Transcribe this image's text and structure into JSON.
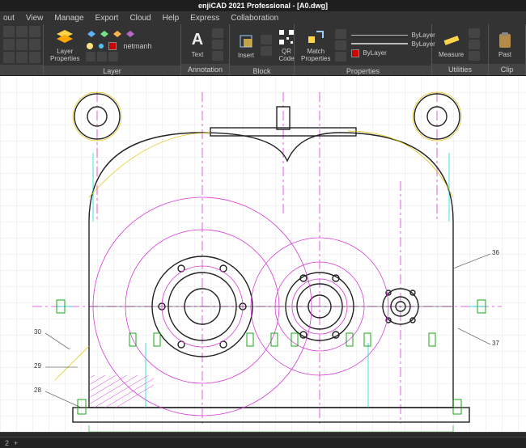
{
  "app": {
    "title": "enjiCAD 2021 Professional - [A0.dwg]"
  },
  "menu": {
    "items": [
      "out",
      "View",
      "Manage",
      "Export",
      "Cloud",
      "Help",
      "Express",
      "Collaboration"
    ]
  },
  "ribbon": {
    "layer_panel": {
      "label": "Layer",
      "layer_properties_btn": "Layer\nProperties",
      "current_layer": "netmanh"
    },
    "annotation_panel": {
      "label": "Annotation",
      "text_btn": "Text"
    },
    "block_panel": {
      "label": "Block",
      "insert_btn": "Insert",
      "qr_btn": "QR\nCode"
    },
    "properties_panel": {
      "label": "Properties",
      "match_btn": "Match\nProperties",
      "line_bylayer": "ByLayer",
      "weight_bylayer": "ByLayer",
      "color_bylayer": "ByLayer"
    },
    "utilities_panel": {
      "label": "Utilities",
      "measure_btn": "Measure"
    },
    "clipboard_panel": {
      "label": "Clip",
      "paste_btn": "Past"
    }
  },
  "drawing": {
    "callouts": {
      "c28": "28",
      "c29": "29",
      "c30": "30",
      "c36": "36",
      "c37": "37"
    },
    "colors": {
      "outline": "#222",
      "magenta": "#d63bd6",
      "cyan": "#00d0d0",
      "yellow": "#e0c000",
      "green": "#00a000",
      "grid": "#d5d5d5"
    }
  },
  "status": {
    "coord_label": "2",
    "plus": "+"
  }
}
